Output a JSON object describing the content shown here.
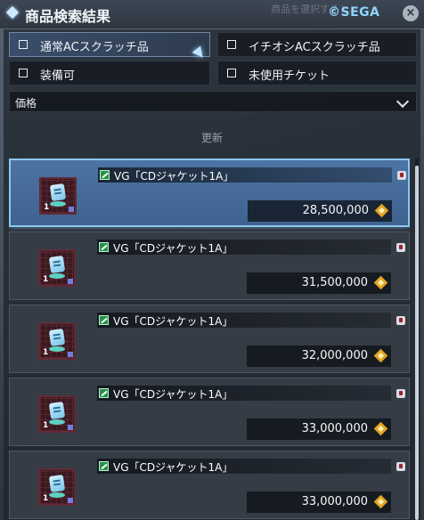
{
  "window": {
    "title": "商品検索結果",
    "copyright": "©SEGA",
    "ghost_text": "商品を選択すると…"
  },
  "filters": [
    {
      "label": "通常ACスクラッチ品",
      "checked": false,
      "highlighted": true
    },
    {
      "label": "イチオシACスクラッチ品",
      "checked": false,
      "highlighted": false
    },
    {
      "label": "装備可",
      "checked": false,
      "highlighted": false
    },
    {
      "label": "未使用チケット",
      "checked": false,
      "highlighted": false
    }
  ],
  "sort": {
    "selected": "価格"
  },
  "update_label": "更新",
  "results": [
    {
      "name": "VG「CDジャケット1A」",
      "quantity": "1",
      "price": "28,500,000",
      "selected": true
    },
    {
      "name": "VG「CDジャケット1A」",
      "quantity": "1",
      "price": "31,500,000",
      "selected": false
    },
    {
      "name": "VG「CDジャケット1A」",
      "quantity": "1",
      "price": "32,000,000",
      "selected": false
    },
    {
      "name": "VG「CDジャケット1A」",
      "quantity": "1",
      "price": "33,000,000",
      "selected": false
    },
    {
      "name": "VG「CDジャケット1A」",
      "quantity": "1",
      "price": "33,000,000",
      "selected": false
    }
  ],
  "colors": {
    "accent": "#8cc7ee",
    "selected_bg": "#4d74a4",
    "meseta": "#e3a522"
  },
  "icons": {
    "currency": "meseta-icon",
    "category": "weapon-camo-icon",
    "item": "ticket-icon"
  }
}
